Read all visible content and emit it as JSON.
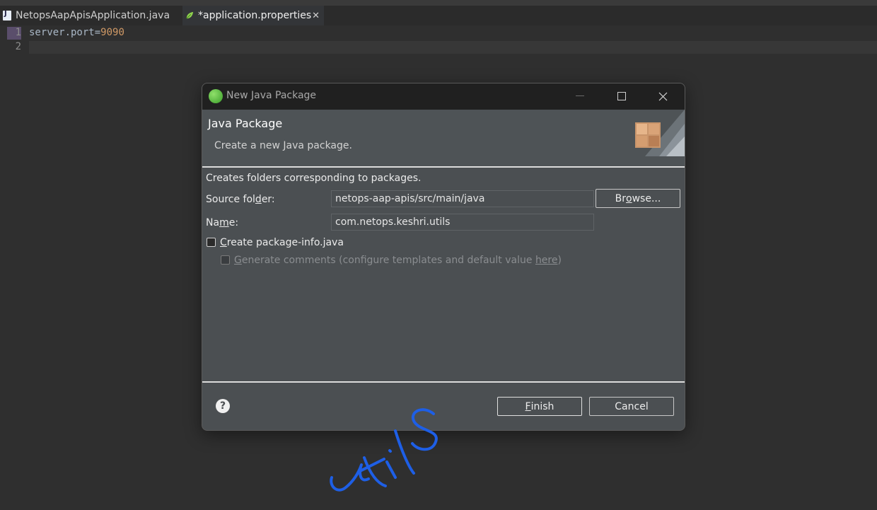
{
  "tabs": [
    {
      "label": "NetopsAapApisApplication.java",
      "icon": "java-file-icon"
    },
    {
      "label": "*application.properties",
      "icon": "leaf-icon",
      "close": "✕"
    }
  ],
  "editor": {
    "line_numbers": [
      "1",
      "2"
    ],
    "line1": {
      "key": "server.port",
      "eq": "=",
      "value": "9090"
    }
  },
  "dialog": {
    "title": "New Java Package",
    "header_title": "Java Package",
    "header_subtitle": "Create a new Java package.",
    "description": "Creates folders corresponding to packages.",
    "source_folder": {
      "label_pre": "Source fol",
      "label_u": "d",
      "label_post": "er:",
      "value": "netops-aap-apis/src/main/java"
    },
    "name": {
      "label_pre": "Na",
      "label_u": "m",
      "label_post": "e:",
      "value": "com.netops.keshri.utils"
    },
    "browse": {
      "pre": "Br",
      "u": "o",
      "post": "wse..."
    },
    "create_pkg_info": {
      "u": "C",
      "post": "reate package-info.java",
      "checked": false
    },
    "generate_comments": {
      "u": "G",
      "mid": "enerate comments (configure templates and default value ",
      "link": "here",
      "post": ")",
      "checked": false
    },
    "finish": {
      "u": "F",
      "post": "inish"
    },
    "cancel": "Cancel",
    "help_glyph": "?"
  },
  "annotation": "utils"
}
